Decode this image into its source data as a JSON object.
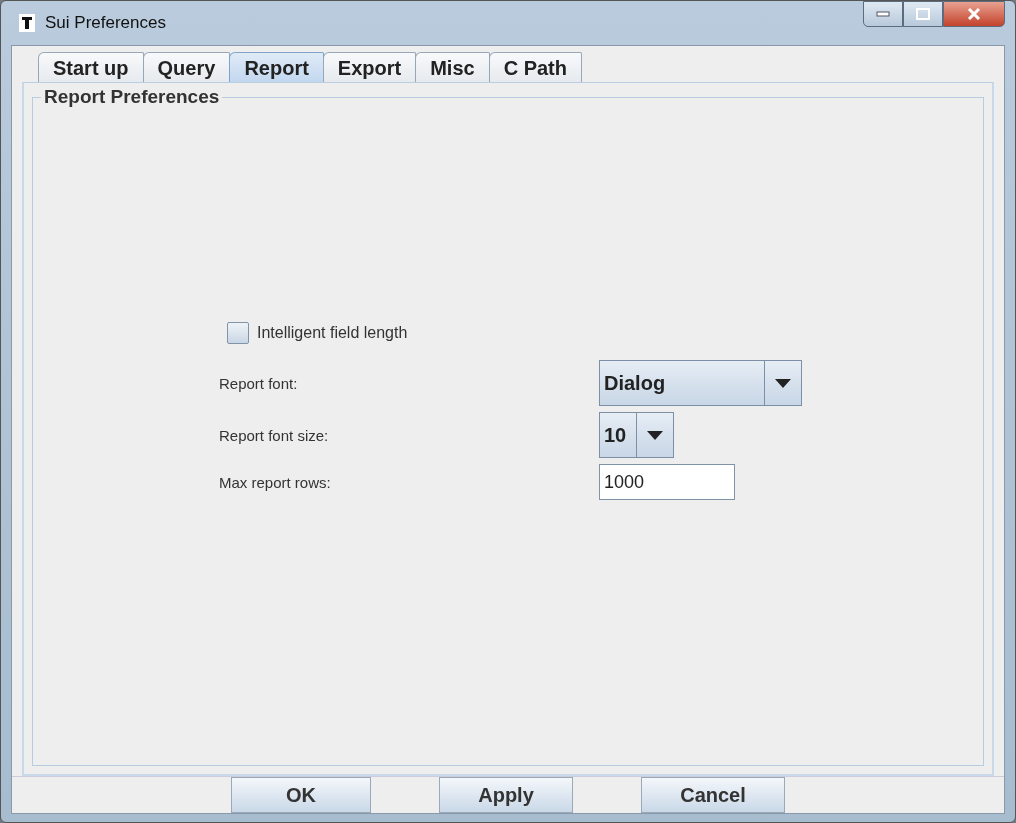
{
  "window": {
    "title": "Sui Preferences"
  },
  "tabs": [
    {
      "label": "Start up",
      "selected": false
    },
    {
      "label": "Query",
      "selected": false
    },
    {
      "label": "Report",
      "selected": true
    },
    {
      "label": "Export",
      "selected": false
    },
    {
      "label": "Misc",
      "selected": false
    },
    {
      "label": "C Path",
      "selected": false
    }
  ],
  "group": {
    "title": "Report Preferences"
  },
  "checkbox": {
    "label": "Intelligent field length",
    "checked": false
  },
  "fields": [
    {
      "kind": "combo",
      "label": "Report font:",
      "value": "Dialog"
    },
    {
      "kind": "combo-small",
      "label": "Report font size:",
      "value": "10"
    },
    {
      "kind": "text",
      "label": "Max report rows:",
      "value": "1000"
    }
  ],
  "buttons": [
    "OK",
    "Apply",
    "Cancel"
  ]
}
